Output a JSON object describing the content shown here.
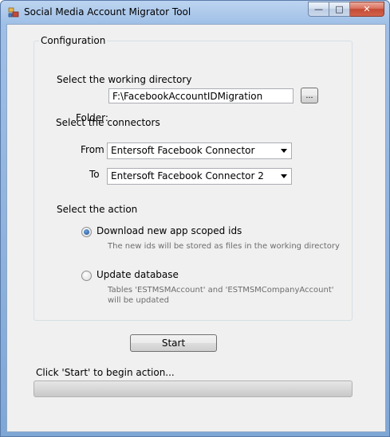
{
  "window": {
    "title": "Social Media Account Migrator Tool",
    "controls": {
      "minimize": "—",
      "maximize": "□",
      "close": "✕"
    }
  },
  "config": {
    "group_label": "Configuration",
    "working_dir_heading": "Select the working directory",
    "folder_label": "Folder:",
    "folder_value": "F:\\FacebookAccountIDMigration",
    "browse_label": "...",
    "connectors_heading": "Select the connectors",
    "from_label": "From",
    "from_value": "Entersoft Facebook Connector",
    "to_label": "To",
    "to_value": "Entersoft Facebook Connector 2",
    "action_heading": "Select the action",
    "actions": [
      {
        "label": "Download new app scoped ids",
        "hint": "The new ids will be stored as files in the working directory",
        "selected": true
      },
      {
        "label": "Update database",
        "hint_line1": "Tables 'ESTMSMAccount' and 'ESTMSMCompanyAccount'",
        "hint_line2": "will be updated",
        "selected": false
      }
    ]
  },
  "start_label": "Start",
  "status_text": "Click 'Start' to begin action...",
  "progress": 0
}
